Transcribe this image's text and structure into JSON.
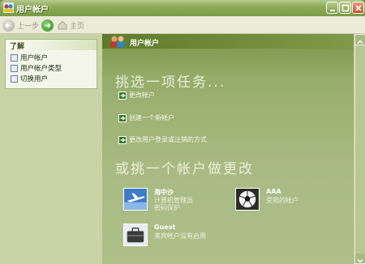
{
  "window": {
    "title": "用户帐户"
  },
  "toolbar": {
    "back_label": "上一步",
    "home_label": "主页"
  },
  "sidebar": {
    "heading": "了解",
    "items": [
      {
        "label": "用户帐户"
      },
      {
        "label": "用户帐户类型"
      },
      {
        "label": "切换用户"
      }
    ]
  },
  "main": {
    "header": "用户帐户",
    "pick_task": "挑选一项任务...",
    "actions": [
      {
        "label": "更改帐户"
      },
      {
        "label": "创建一个新帐户"
      },
      {
        "label": "更改用户登录或注销的方式"
      }
    ],
    "pick_account": "或挑一个帐户做更改",
    "accounts": [
      {
        "name": "海中沙",
        "line1": "计算机管理员",
        "line2": "密码保护"
      },
      {
        "name": "AAA",
        "line1": "受限的帐户",
        "line2": ""
      },
      {
        "name": "Guest",
        "line1": "来宾帐户没有启用",
        "line2": ""
      }
    ]
  }
}
